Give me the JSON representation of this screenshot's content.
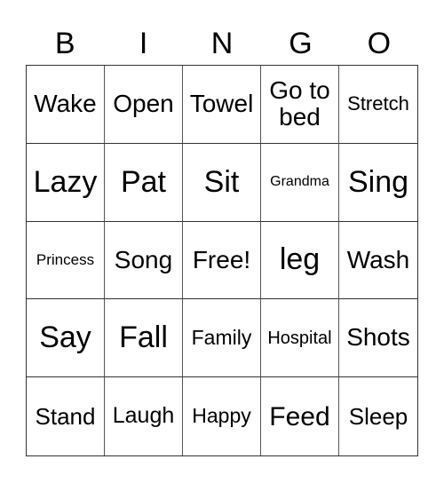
{
  "header": [
    "B",
    "I",
    "N",
    "G",
    "O"
  ],
  "cells": [
    {
      "text": "Wake",
      "size": 28
    },
    {
      "text": "Open",
      "size": 28
    },
    {
      "text": "Towel",
      "size": 28
    },
    {
      "text": "Go to bed",
      "size": 28
    },
    {
      "text": "Stretch",
      "size": 22
    },
    {
      "text": "Lazy",
      "size": 34
    },
    {
      "text": "Pat",
      "size": 34
    },
    {
      "text": "Sit",
      "size": 34
    },
    {
      "text": "Grandma",
      "size": 16
    },
    {
      "text": "Sing",
      "size": 34
    },
    {
      "text": "Princess",
      "size": 17
    },
    {
      "text": "Song",
      "size": 28
    },
    {
      "text": "Free!",
      "size": 28
    },
    {
      "text": "leg",
      "size": 34
    },
    {
      "text": "Wash",
      "size": 28
    },
    {
      "text": "Say",
      "size": 34
    },
    {
      "text": "Fall",
      "size": 34
    },
    {
      "text": "Family",
      "size": 23
    },
    {
      "text": "Hospital",
      "size": 20
    },
    {
      "text": "Shots",
      "size": 28
    },
    {
      "text": "Stand",
      "size": 26
    },
    {
      "text": "Laugh",
      "size": 25
    },
    {
      "text": "Happy",
      "size": 23
    },
    {
      "text": "Feed",
      "size": 30
    },
    {
      "text": "Sleep",
      "size": 26
    }
  ]
}
